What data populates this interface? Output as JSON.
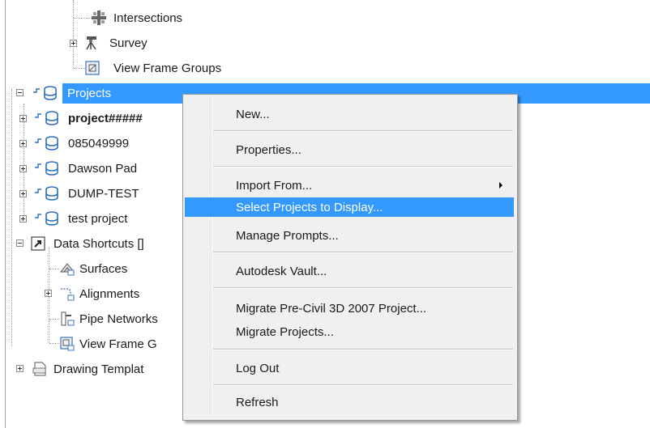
{
  "tree": {
    "items": [
      {
        "label": "Intersections"
      },
      {
        "label": "Survey"
      },
      {
        "label": "View Frame Groups"
      },
      {
        "label": "Projects"
      },
      {
        "label": "project#####"
      },
      {
        "label": "085049999"
      },
      {
        "label": "Dawson Pad"
      },
      {
        "label": "DUMP-TEST"
      },
      {
        "label": "test project"
      },
      {
        "label": "Data Shortcuts []"
      },
      {
        "label": "Surfaces"
      },
      {
        "label": "Alignments"
      },
      {
        "label": "Pipe Networks"
      },
      {
        "label": "View Frame G"
      },
      {
        "label": "Drawing Templat"
      }
    ]
  },
  "context_menu": {
    "items": [
      {
        "label": "New..."
      },
      {
        "label": "Properties..."
      },
      {
        "label": "Import From..."
      },
      {
        "label": "Select Projects to Display..."
      },
      {
        "label": "Manage Prompts..."
      },
      {
        "label": "Autodesk Vault..."
      },
      {
        "label": "Migrate Pre-Civil 3D 2007 Project..."
      },
      {
        "label": "Migrate Projects..."
      },
      {
        "label": "Log Out"
      },
      {
        "label": "Refresh"
      }
    ],
    "highlighted": "Select Projects to Display..."
  },
  "colors": {
    "selection": "#3399ff",
    "menu_bg": "#f0f0f0",
    "db_icon": "#2f6fc0"
  }
}
